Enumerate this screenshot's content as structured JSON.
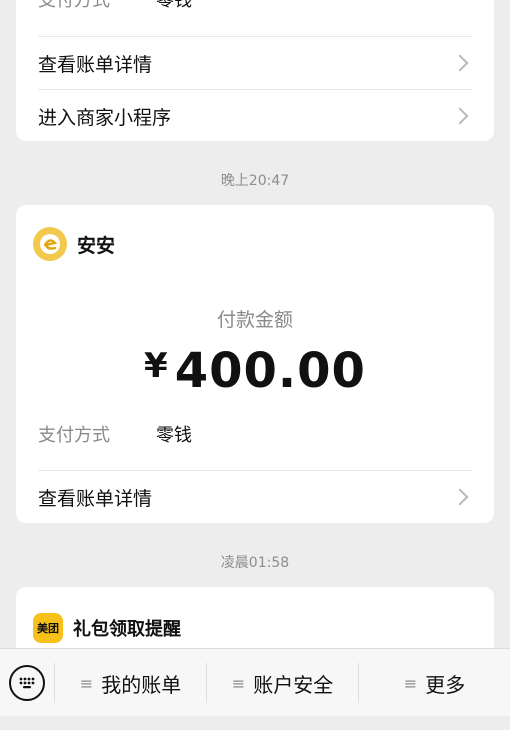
{
  "card_top": {
    "pay_method_label": "支付方式",
    "pay_method_value": "零钱",
    "view_bill": "查看账单详情",
    "merchant_mini": "进入商家小程序"
  },
  "time1": "晚上20:47",
  "card_payment": {
    "merchant_name": "安安",
    "amount_title": "付款金额",
    "currency": "¥",
    "amount": "400.00",
    "pay_method_label": "支付方式",
    "pay_method_value": "零钱",
    "view_bill": "查看账单详情"
  },
  "time2": "凌晨01:58",
  "card_gift": {
    "brand_logo_text": "美团",
    "title": "礼包领取提醒"
  },
  "bottom_menu": {
    "items": [
      {
        "label": "我的账单"
      },
      {
        "label": "账户安全"
      },
      {
        "label": "更多"
      }
    ]
  },
  "colors": {
    "background": "#ededed",
    "merchant_logo": "#f2c94c",
    "meituan_yellow": "#f7c11a"
  }
}
